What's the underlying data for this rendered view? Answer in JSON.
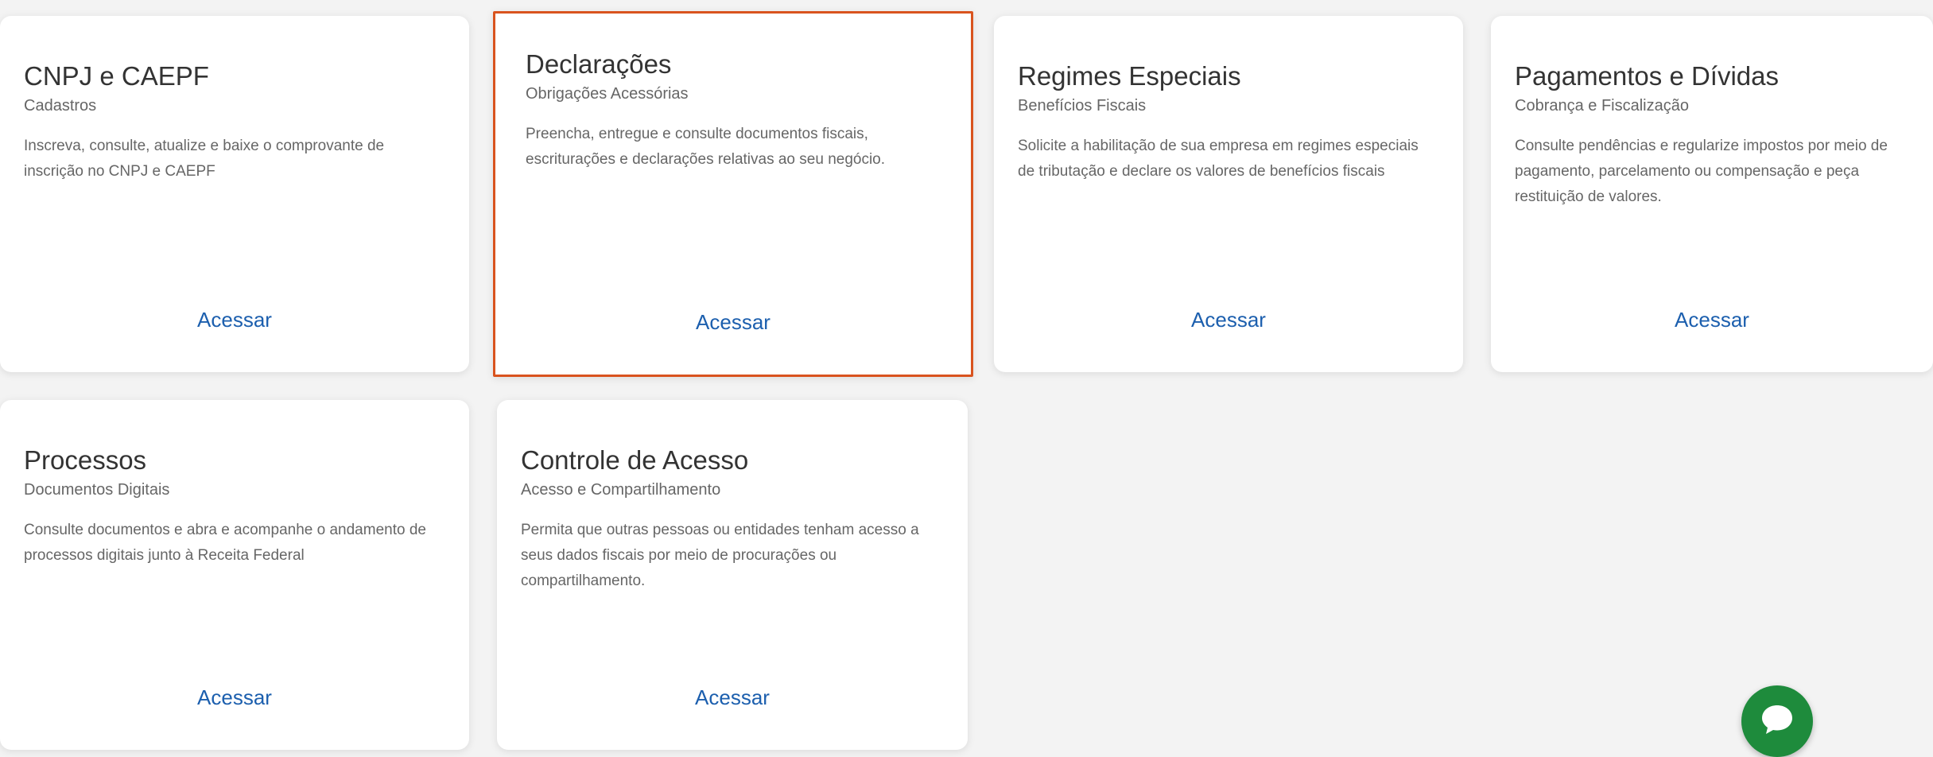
{
  "cards": [
    {
      "title": "CNPJ e CAEPF",
      "subtitle": "Cadastros",
      "description": "Inscreva, consulte, atualize e baixe o comprovante de inscrição no CNPJ e CAEPF",
      "link": "Acessar"
    },
    {
      "title": "Declarações",
      "subtitle": "Obrigações Acessórias",
      "description": "Preencha, entregue e consulte documentos fiscais, escriturações e declarações relativas ao seu negócio.",
      "link": "Acessar"
    },
    {
      "title": "Regimes Especiais",
      "subtitle": "Benefícios Fiscais",
      "description": "Solicite a habilitação de sua empresa em regimes especiais de tributação e declare os valores de benefícios fiscais",
      "link": "Acessar"
    },
    {
      "title": "Pagamentos e Dívidas",
      "subtitle": "Cobrança e Fiscalização",
      "description": "Consulte pendências e regularize impostos por meio de pagamento, parcelamento ou compensação e peça restituição de valores.",
      "link": "Acessar"
    },
    {
      "title": "Processos",
      "subtitle": "Documentos Digitais",
      "description": "Consulte documentos e abra e acompanhe o andamento de processos digitais junto à Receita Federal",
      "link": "Acessar"
    },
    {
      "title": "Controle de Acesso",
      "subtitle": "Acesso e Compartilhamento",
      "description": "Permita que outras pessoas ou entidades tenham acesso a seus dados fiscais por meio de procurações ou compartilhamento.",
      "link": "Acessar"
    }
  ],
  "colors": {
    "selected_border": "#d9531e",
    "link": "#1c5fae",
    "chat_button": "#1e8b3c"
  },
  "chat_button": {
    "icon": "chat-bubble-icon"
  }
}
